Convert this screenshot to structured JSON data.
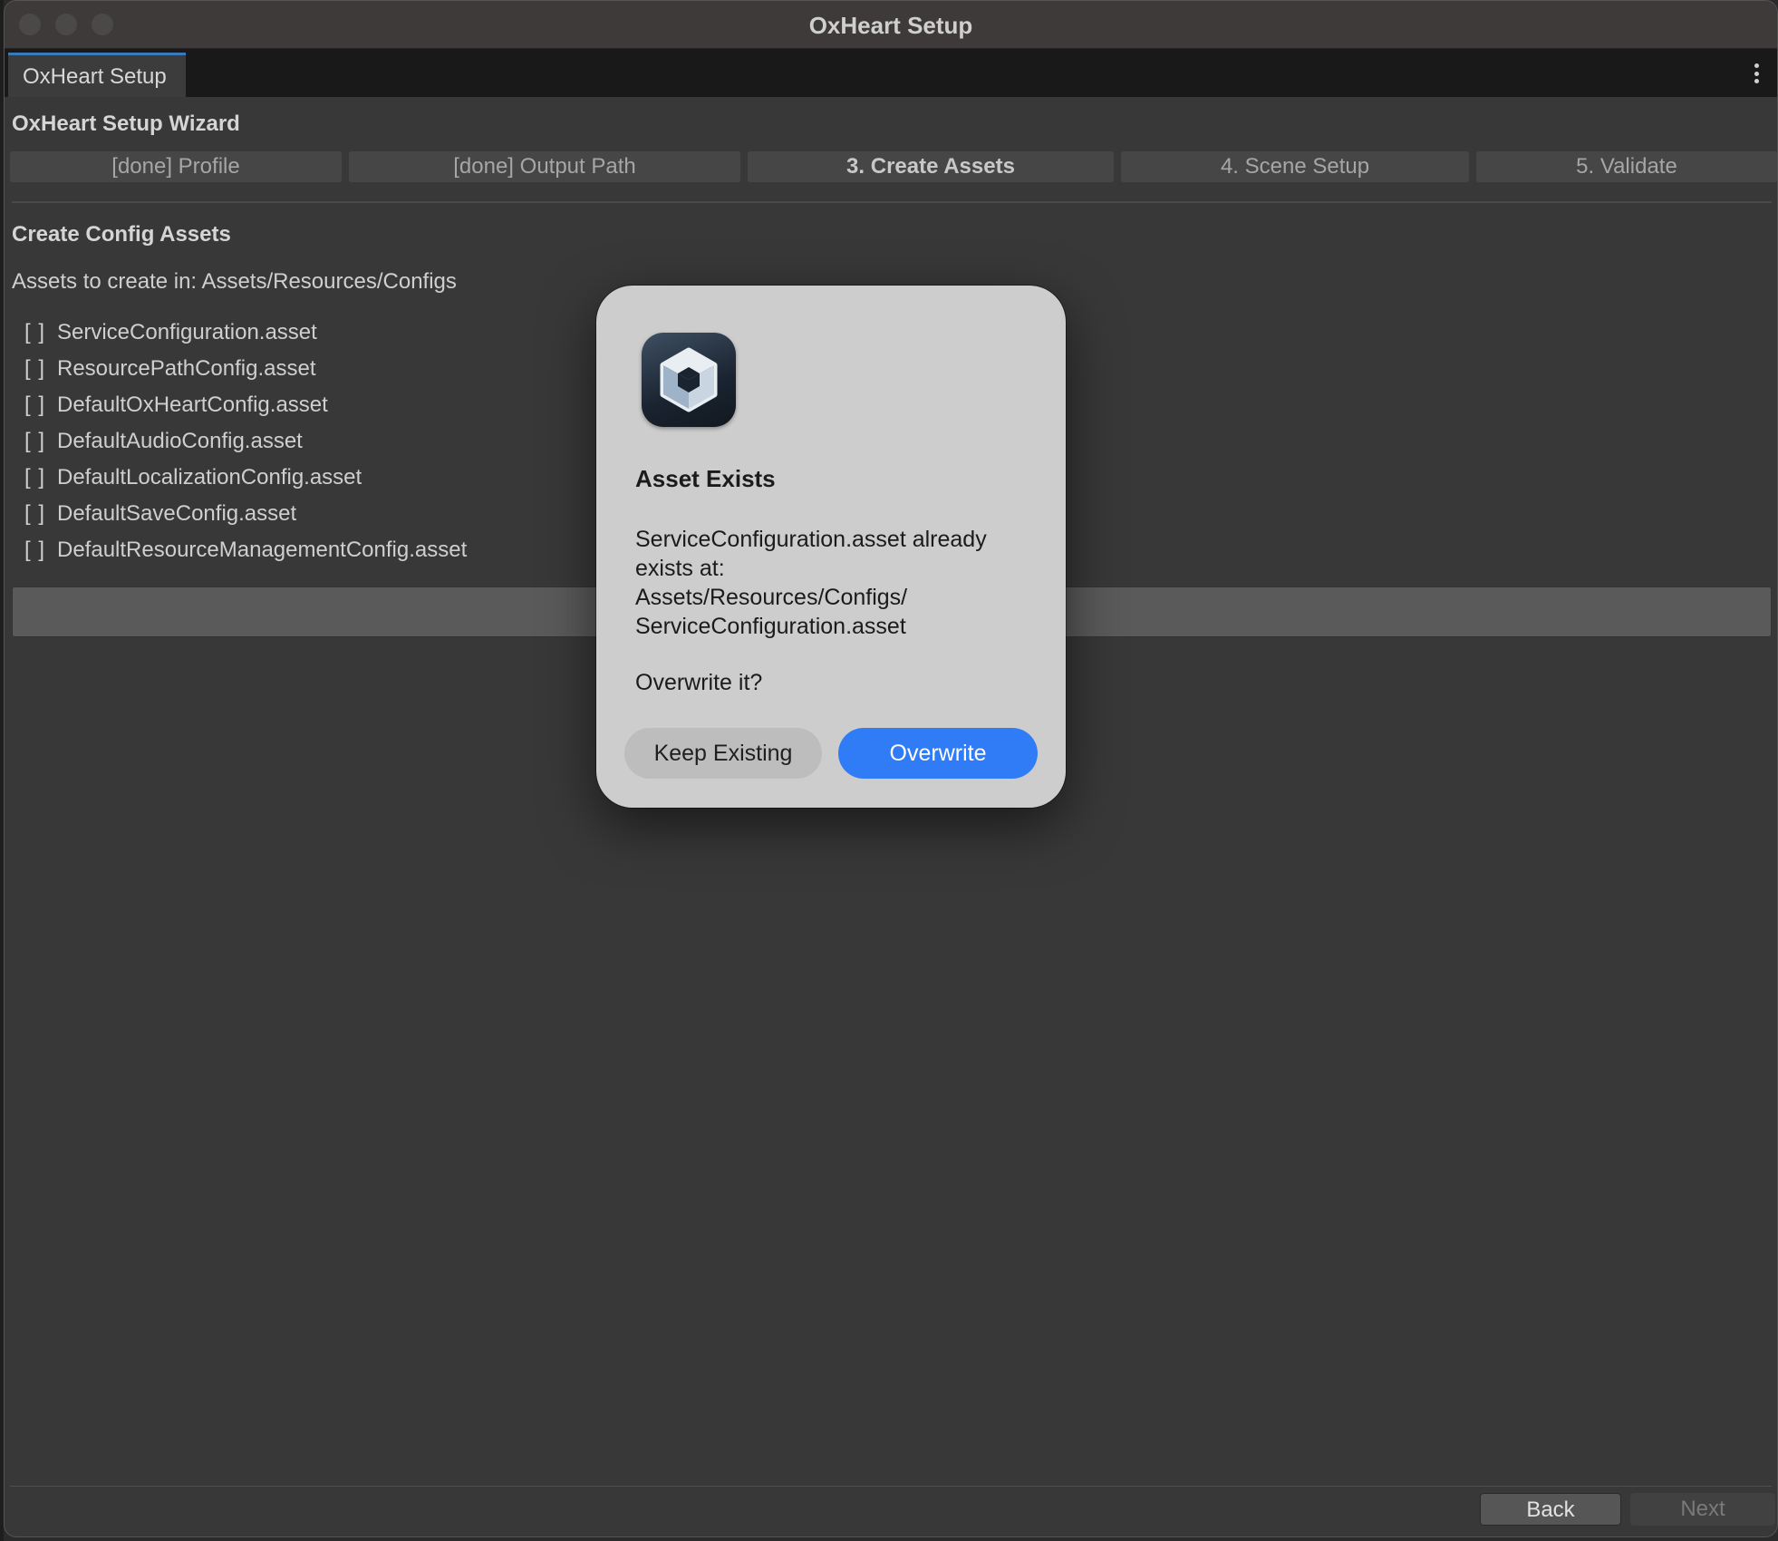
{
  "window": {
    "title": "OxHeart Setup"
  },
  "tabs": [
    {
      "label": "OxHeart Setup"
    }
  ],
  "wizard": {
    "title": "OxHeart Setup Wizard",
    "steps": [
      {
        "label": "[done] Profile"
      },
      {
        "label": "[done] Output Path"
      },
      {
        "label": "3. Create Assets"
      },
      {
        "label": "4. Scene Setup"
      },
      {
        "label": "5. Validate"
      }
    ]
  },
  "section": {
    "title": "Create Config Assets",
    "path_line": "Assets to create in: Assets/Resources/Configs",
    "assets": [
      {
        "box": "[ ]",
        "name": "ServiceConfiguration.asset"
      },
      {
        "box": "[ ]",
        "name": "ResourcePathConfig.asset"
      },
      {
        "box": "[ ]",
        "name": "DefaultOxHeartConfig.asset"
      },
      {
        "box": "[ ]",
        "name": "DefaultAudioConfig.asset"
      },
      {
        "box": "[ ]",
        "name": "DefaultLocalizationConfig.asset"
      },
      {
        "box": "[ ]",
        "name": "DefaultSaveConfig.asset"
      },
      {
        "box": "[ ]",
        "name": "DefaultResourceManagementConfig.asset"
      }
    ]
  },
  "footer": {
    "back_label": "Back",
    "next_label": "Next"
  },
  "dialog": {
    "icon": "unity-icon",
    "title": "Asset Exists",
    "message_lines": [
      "ServiceConfiguration.asset already",
      "exists at:",
      "Assets/Resources/Configs/",
      "ServiceConfiguration.asset"
    ],
    "question": "Overwrite it?",
    "keep_label": "Keep Existing",
    "overwrite_label": "Overwrite",
    "accent_color": "#2f7cf6"
  }
}
